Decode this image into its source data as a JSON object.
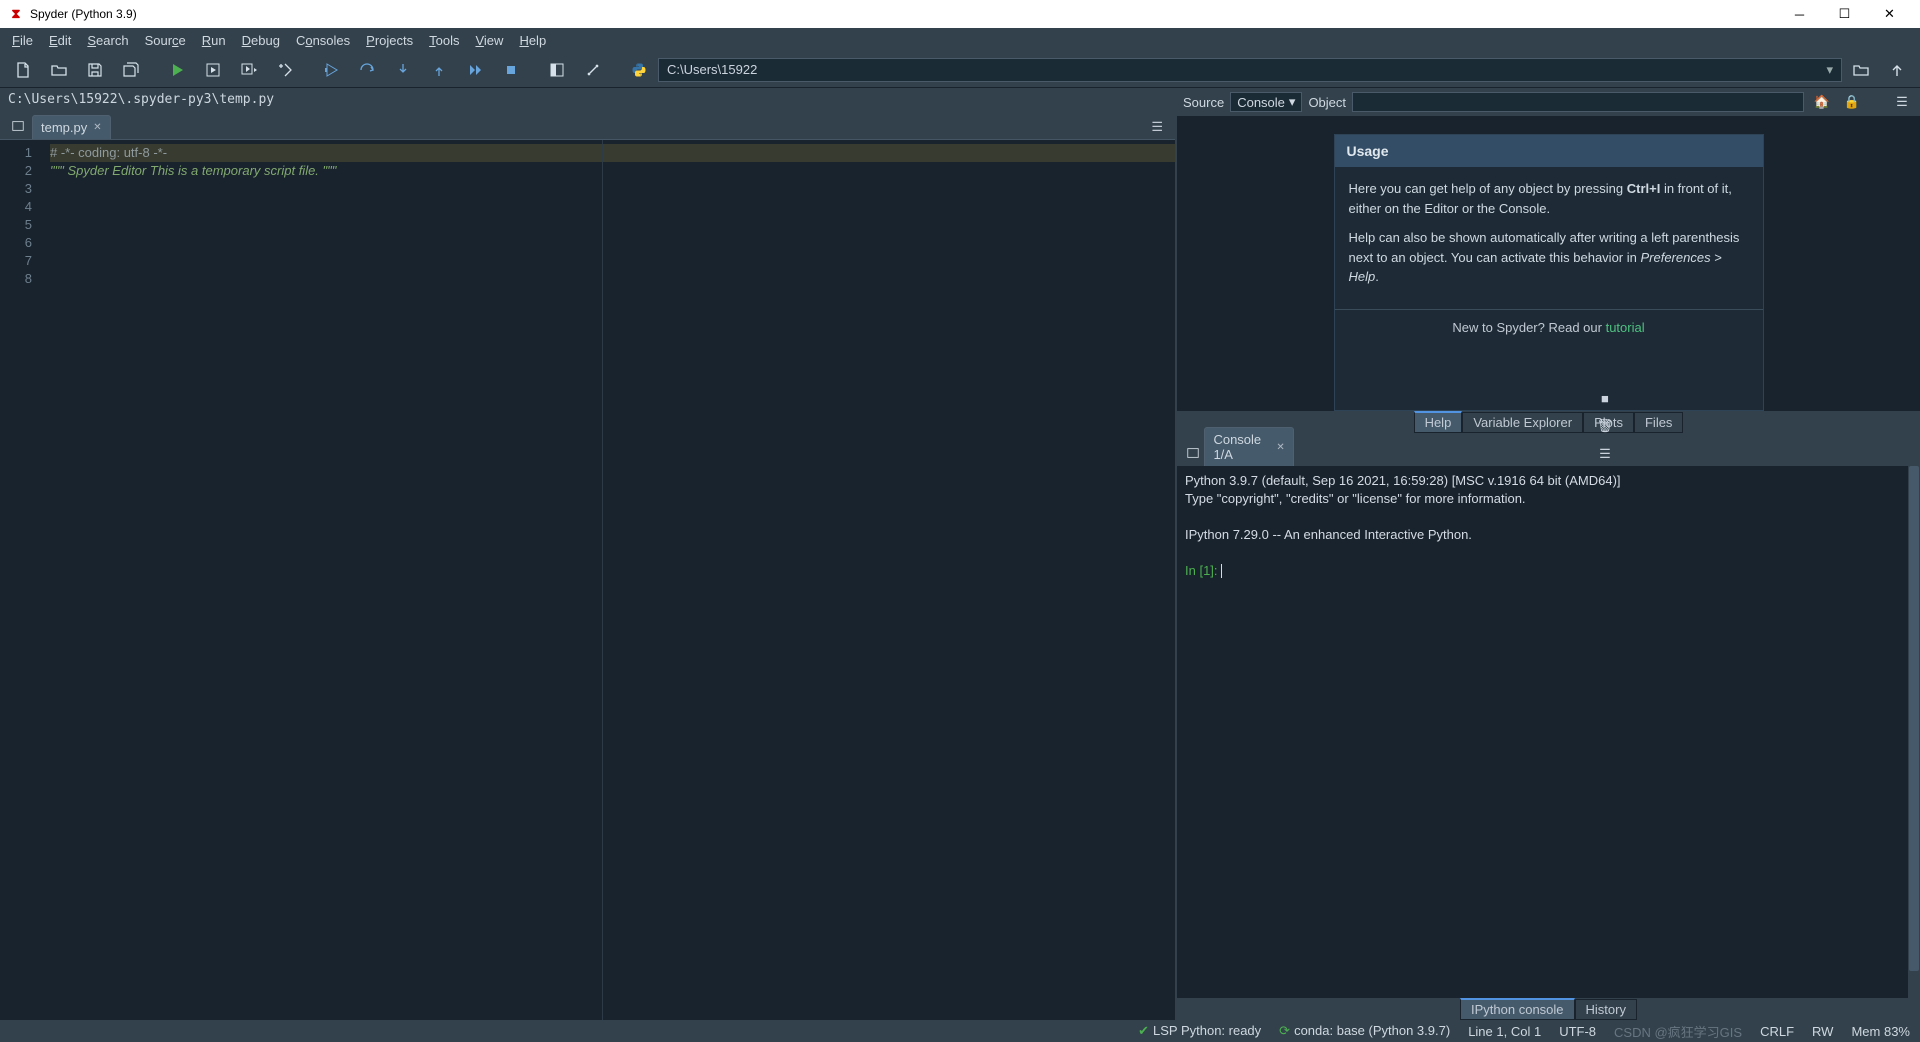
{
  "window": {
    "title": "Spyder (Python 3.9)"
  },
  "menus": [
    "File",
    "Edit",
    "Search",
    "Source",
    "Run",
    "Debug",
    "Consoles",
    "Projects",
    "Tools",
    "View",
    "Help"
  ],
  "toolbar": {
    "cwd": "C:\\Users\\15922"
  },
  "editor": {
    "path": "C:\\Users\\15922\\.spyder-py3\\temp.py",
    "tab": "temp.py",
    "lines": [
      "# -*- coding: utf-8 -*-",
      "\"\"\"",
      "Spyder Editor",
      "",
      "This is a temporary script file.",
      "\"\"\"",
      "",
      ""
    ]
  },
  "help": {
    "source_label": "Source",
    "source_value": "Console",
    "object_label": "Object",
    "title": "Usage",
    "p1a": "Here you can get help of any object by pressing ",
    "p1b": "Ctrl+I",
    "p1c": " in front of it, either on the Editor or the Console.",
    "p2a": "Help can also be shown automatically after writing a left parenthesis next to an object. You can activate this behavior in ",
    "p2b": "Preferences > Help",
    "p2c": ".",
    "foot_a": "New to Spyder? Read our ",
    "foot_link": "tutorial"
  },
  "pane_tabs": {
    "help": "Help",
    "vars": "Variable Explorer",
    "plots": "Plots",
    "files": "Files"
  },
  "console": {
    "tab": "Console 1/A",
    "line1": "Python 3.9.7 (default, Sep 16 2021, 16:59:28) [MSC v.1916 64 bit (AMD64)]",
    "line2": "Type \"copyright\", \"credits\" or \"license\" for more information.",
    "line3": "IPython 7.29.0 -- An enhanced Interactive Python.",
    "prompt": "In [1]: "
  },
  "cons_tabs": {
    "ipy": "IPython console",
    "hist": "History"
  },
  "status": {
    "lsp": "LSP Python: ready",
    "conda": "conda: base (Python 3.9.7)",
    "cursor": "Line 1, Col 1",
    "enc": "UTF-8",
    "eol": "CRLF",
    "rw": "RW",
    "mem": "Mem 83%",
    "watermark": "CSDN @疯狂学习GIS"
  }
}
